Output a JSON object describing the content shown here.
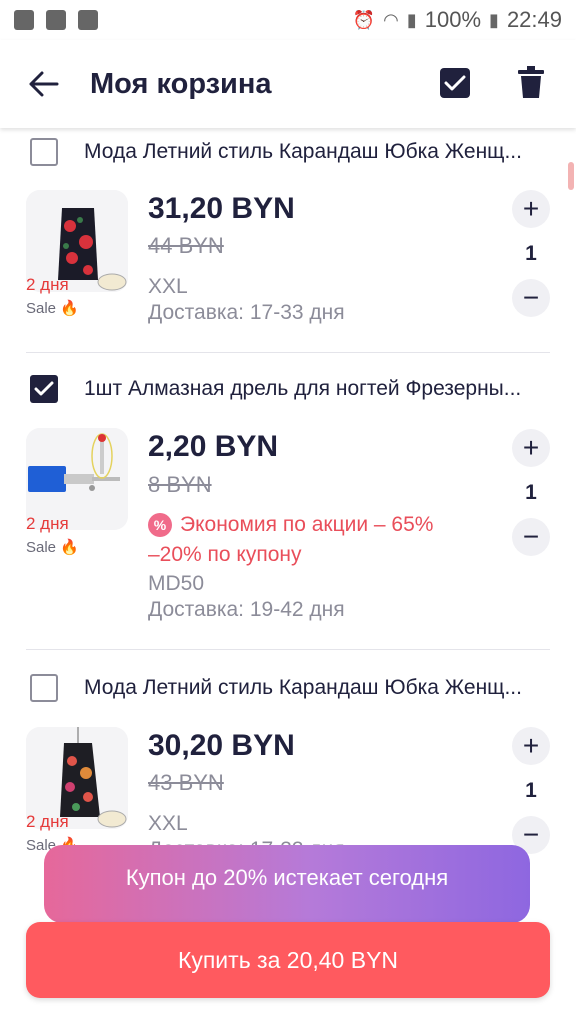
{
  "status_bar": {
    "battery": "100%",
    "time": "22:49"
  },
  "header": {
    "title": "Моя корзина",
    "back_icon": "arrow-left-icon",
    "select_all_icon": "checkbox-checked-icon",
    "delete_icon": "trash-icon"
  },
  "items": [
    {
      "title": "Мода Летний стиль Карандаш Юбка Женщ...",
      "checked": false,
      "days": "2 дня",
      "sale": "Sale 🔥",
      "price": "31,20 BYN",
      "old_price": "44 BYN",
      "variant": "XXL",
      "delivery": "Доставка: 17-33 дня",
      "quantity": "1"
    },
    {
      "title": "1шт Алмазная дрель для ногтей Фрезерны...",
      "checked": true,
      "days": "2 дня",
      "sale": "Sale 🔥",
      "price": "2,20 BYN",
      "old_price": "8 BYN",
      "promo": "Экономия по акции – 65%",
      "coupon": "–20% по купону",
      "variant": "MD50",
      "delivery": "Доставка: 19-42 дня",
      "quantity": "1"
    },
    {
      "title": "Мода Летний стиль Карандаш Юбка Женщ...",
      "checked": false,
      "days": "2 дня",
      "sale": "Sale 🔥",
      "price": "30,20 BYN",
      "old_price": "43 BYN",
      "variant": "XXL",
      "delivery": "Доставка: 17-33 дня",
      "quantity": "1"
    }
  ],
  "coupon_banner": "Купон до 20% истекает сегодня",
  "buy_button": "Купить за 20,40 BYN",
  "colors": {
    "accent": "#ff5a5f",
    "dark": "#20213d",
    "promo": "#e94e5a"
  }
}
